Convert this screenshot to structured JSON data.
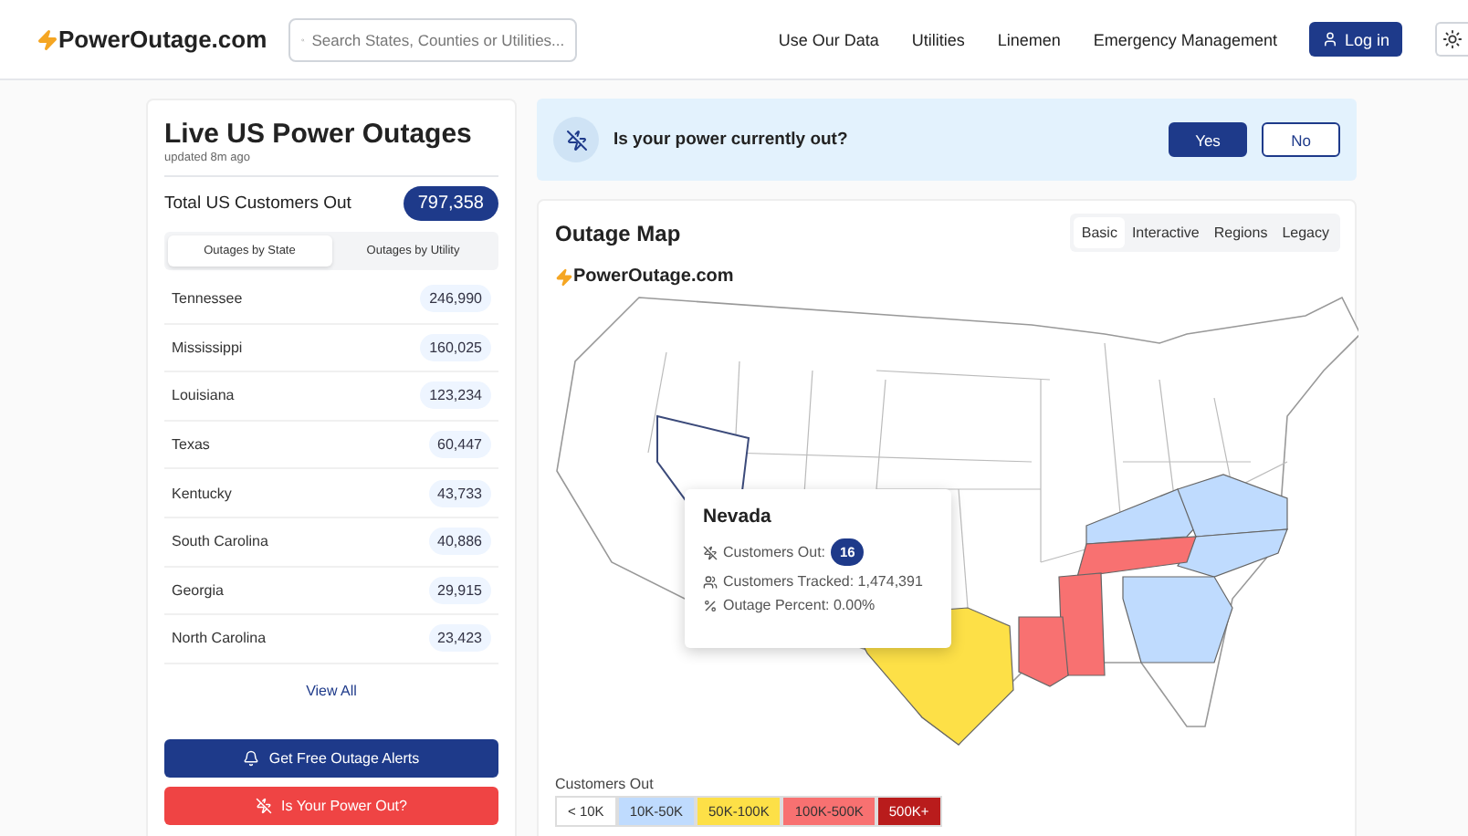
{
  "header": {
    "logo": "PowerOutage.com",
    "search": {
      "placeholder": "Search States, Counties or Utilities..."
    },
    "nav": [
      "Use Our Data",
      "Utilities",
      "Linemen",
      "Emergency Management"
    ],
    "login": "Log in"
  },
  "sidebar": {
    "title": "Live US Power Outages",
    "updated": "updated 8m ago",
    "total_label": "Total US Customers Out",
    "total": "797,358",
    "tabs": [
      {
        "label": "Outages by State",
        "selected": true
      },
      {
        "label": "Outages by Utility",
        "selected": false
      }
    ],
    "rows": [
      {
        "name": "Tennessee",
        "count": "246,990"
      },
      {
        "name": "Mississippi",
        "count": "160,025"
      },
      {
        "name": "Louisiana",
        "count": "123,234"
      },
      {
        "name": "Texas",
        "count": "60,447"
      },
      {
        "name": "Kentucky",
        "count": "43,733"
      },
      {
        "name": "South Carolina",
        "count": "40,886"
      },
      {
        "name": "Georgia",
        "count": "29,915"
      },
      {
        "name": "North Carolina",
        "count": "23,423"
      }
    ],
    "view_all": "View All",
    "alerts_button": "Get Free Outage Alerts",
    "report_button": "Is Your Power Out?"
  },
  "banner": {
    "question": "Is your power currently out?",
    "buttons": [
      "Yes",
      "No"
    ]
  },
  "map": {
    "title": "Outage Map",
    "tabs": [
      {
        "label": "Basic",
        "selected": true
      },
      {
        "label": "Interactive",
        "selected": false
      },
      {
        "label": "Regions",
        "selected": false
      },
      {
        "label": "Legacy",
        "selected": false
      }
    ],
    "watermark": "PowerOutage.com",
    "tooltip": {
      "state": "Nevada",
      "out_label": "Customers Out:",
      "out": "16",
      "tracked": "Customers Tracked: 1,474,391",
      "percent": "Outage Percent: 0.00%"
    },
    "legend_title": "Customers Out",
    "legend": [
      {
        "label": "< 10K",
        "color": "#ffffff"
      },
      {
        "label": "10K-50K",
        "color": "#bfdbfe"
      },
      {
        "label": "50K-100K",
        "color": "#fde047"
      },
      {
        "label": "100K-500K",
        "color": "#f87171"
      },
      {
        "label": "500K+",
        "color": "#b91c1c"
      }
    ]
  }
}
